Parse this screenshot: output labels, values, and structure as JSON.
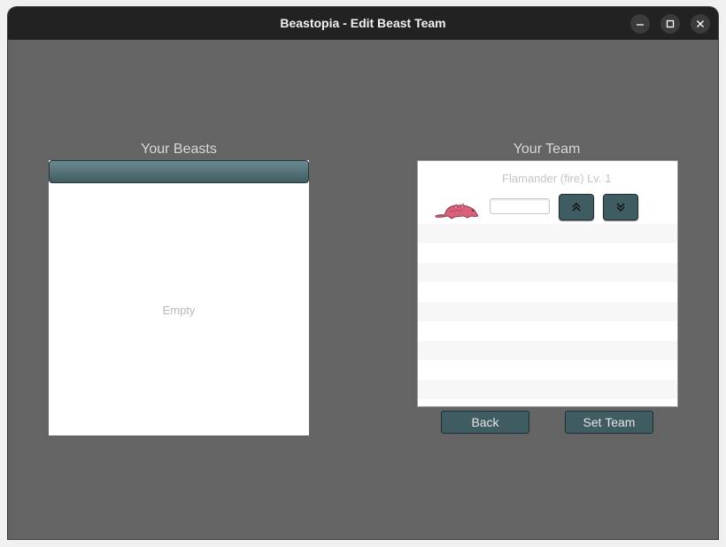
{
  "window": {
    "title": "Beastopia - Edit Beast Team",
    "controls": [
      "minimize-icon",
      "maximize-icon",
      "close-icon"
    ]
  },
  "beasts": {
    "heading": "Your Beasts",
    "empty_text": "Empty"
  },
  "team": {
    "heading": "Your Team",
    "members": [
      {
        "name": "Flamander (fire) Lv. 1",
        "nickname_value": "",
        "sprite_icon": "flamander-sprite-icon",
        "move_up_icon": "double-chevron-up-icon",
        "move_down_icon": "double-chevron-down-icon"
      }
    ]
  },
  "buttons": {
    "back_label": "Back",
    "set_team_label": "Set Team"
  },
  "colors": {
    "background": "#646464",
    "titlebar": "#222222",
    "button": "#3f5c62",
    "button_text": "#e6e6e6",
    "heading_text": "#d8d8d8"
  }
}
